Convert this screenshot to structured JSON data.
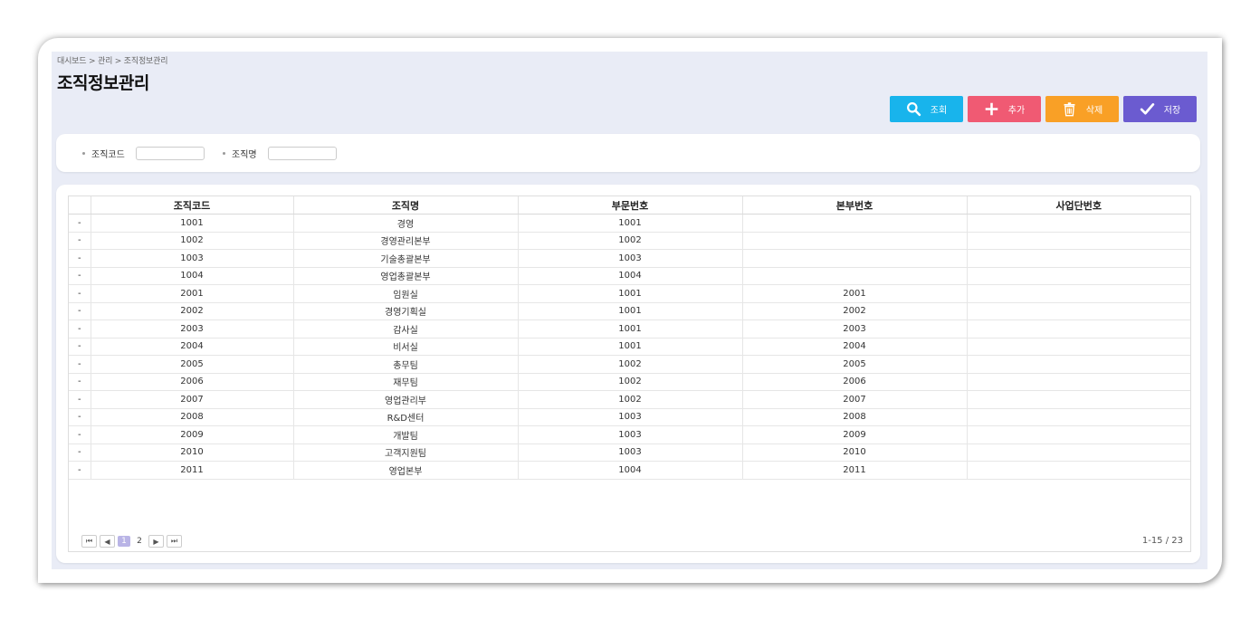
{
  "breadcrumb": "대시보드 > 관리 > 조직정보관리",
  "page_title": "조직정보관리",
  "toolbar": {
    "search_label": "조회",
    "add_label": "추가",
    "delete_label": "삭제",
    "save_label": "저장",
    "colors": {
      "search": "#18b4ec",
      "add": "#f05a73",
      "delete": "#f9a026",
      "save": "#6b5bd0"
    },
    "icons": {
      "search": "search-icon",
      "add": "plus-icon",
      "delete": "trash-icon",
      "save": "check-icon"
    }
  },
  "filters": {
    "org_code_label": "조직코드",
    "org_code_value": "",
    "org_name_label": "조직명",
    "org_name_value": ""
  },
  "table": {
    "columns": [
      "",
      "조직코드",
      "조직명",
      "부문번호",
      "본부번호",
      "사업단번호"
    ],
    "rows": [
      [
        "-",
        "1001",
        "경영",
        "1001",
        "",
        ""
      ],
      [
        "-",
        "1002",
        "경영관리본부",
        "1002",
        "",
        ""
      ],
      [
        "-",
        "1003",
        "기술총괄본부",
        "1003",
        "",
        ""
      ],
      [
        "-",
        "1004",
        "영업총괄본부",
        "1004",
        "",
        ""
      ],
      [
        "-",
        "2001",
        "임원실",
        "1001",
        "2001",
        ""
      ],
      [
        "-",
        "2002",
        "경영기획실",
        "1001",
        "2002",
        ""
      ],
      [
        "-",
        "2003",
        "감사실",
        "1001",
        "2003",
        ""
      ],
      [
        "-",
        "2004",
        "비서실",
        "1001",
        "2004",
        ""
      ],
      [
        "-",
        "2005",
        "총무팀",
        "1002",
        "2005",
        ""
      ],
      [
        "-",
        "2006",
        "재무팀",
        "1002",
        "2006",
        ""
      ],
      [
        "-",
        "2007",
        "영업관리부",
        "1002",
        "2007",
        ""
      ],
      [
        "-",
        "2008",
        "R&D센터",
        "1003",
        "2008",
        ""
      ],
      [
        "-",
        "2009",
        "개발팀",
        "1003",
        "2009",
        ""
      ],
      [
        "-",
        "2010",
        "고객지원팀",
        "1003",
        "2010",
        ""
      ],
      [
        "-",
        "2011",
        "영업본부",
        "1004",
        "2011",
        ""
      ]
    ]
  },
  "pagination": {
    "first": "⏮",
    "prev": "◀",
    "pages": [
      "1",
      "2"
    ],
    "current": "1",
    "next": "▶",
    "last": "⏭",
    "info": "1-15 / 23"
  }
}
